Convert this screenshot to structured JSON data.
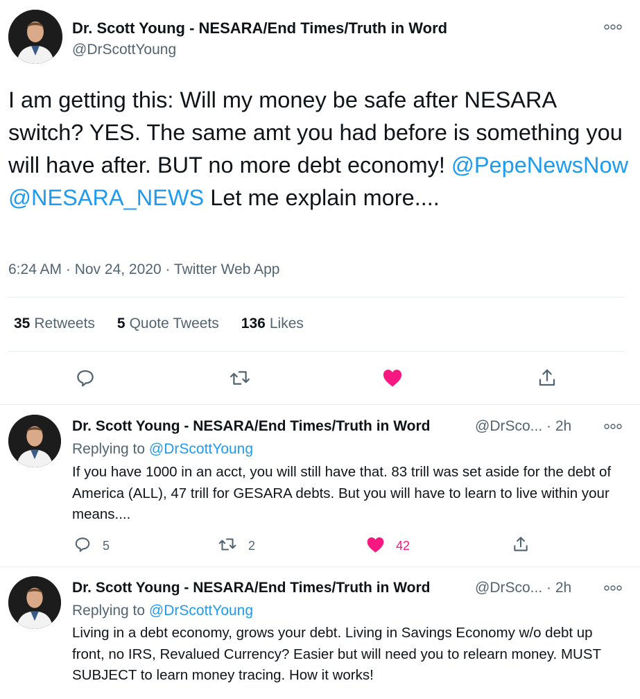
{
  "main_tweet": {
    "display_name": "Dr. Scott Young - NESARA/End Times/Truth in Word",
    "handle": "@DrScottYoung",
    "text_part1": "I am getting this: Will my money be safe after NESARA switch? YES. The same amt you had before is something you will have after. BUT no more debt economy! ",
    "mention1": "@PepeNewsNow",
    "mention2": "@NESARA_NEWS",
    "text_part2": " Let me explain more....",
    "meta": "6:24 AM · Nov 24, 2020 · Twitter Web App",
    "stats": {
      "retweets_count": "35",
      "retweets_label": "Retweets",
      "quotes_count": "5",
      "quotes_label": "Quote Tweets",
      "likes_count": "136",
      "likes_label": "Likes"
    },
    "liked": true
  },
  "replies": [
    {
      "display_name": "Dr. Scott Young - NESARA/End Times/Truth in Word",
      "handle_time": "@DrSco... · 2h",
      "replying_to_label": "Replying to ",
      "replying_to_handle": "@DrScottYoung",
      "text": "If you have 1000 in an acct, you will still have that. 83 trill was set aside for the debt of America (ALL), 47 trill for GESARA debts. But you will have to learn to live within your means....",
      "reply_count": "5",
      "retweet_count": "2",
      "like_count": "42",
      "liked": true
    },
    {
      "display_name": "Dr. Scott Young - NESARA/End Times/Truth in Word",
      "handle_time": "@DrSco... · 2h",
      "replying_to_label": "Replying to ",
      "replying_to_handle": "@DrScottYoung",
      "text": "Living in a debt economy, grows your debt. Living in Savings Economy w/o debt up front, no IRS, Revalued Currency? Easier but will need you to relearn money. MUST SUBJECT to learn money tracing. How it works!"
    }
  ],
  "colors": {
    "text": "#0f1419",
    "secondary": "#536471",
    "link": "#1d9bf0",
    "like": "#f91880",
    "divider": "#e6ecf0"
  },
  "icons": [
    "more-icon",
    "reply-icon",
    "retweet-icon",
    "like-icon",
    "share-icon"
  ]
}
